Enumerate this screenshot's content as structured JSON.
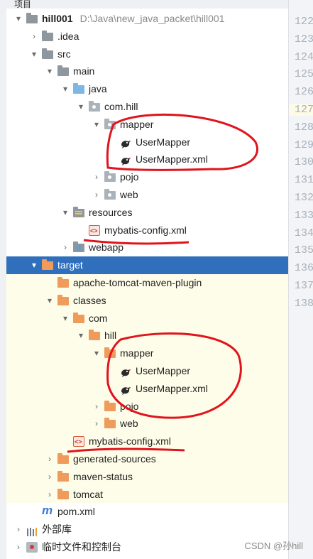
{
  "toolbar": {
    "tab_label": "项目"
  },
  "tree": {
    "rows": [
      {
        "indent": 0,
        "arrow": "▾",
        "icon": "gray-folder",
        "label": "hill001",
        "hint": "D:\\Java\\new_java_packet\\hill001",
        "bold": true
      },
      {
        "indent": 1,
        "arrow": "›",
        "icon": "gray-folder",
        "label": ".idea"
      },
      {
        "indent": 1,
        "arrow": "▾",
        "icon": "gray-folder",
        "label": "src"
      },
      {
        "indent": 2,
        "arrow": "▾",
        "icon": "gray-folder",
        "label": "main"
      },
      {
        "indent": 3,
        "arrow": "▾",
        "icon": "blue-folder",
        "label": "java"
      },
      {
        "indent": 4,
        "arrow": "▾",
        "icon": "package-folder",
        "label": "com.hill"
      },
      {
        "indent": 5,
        "arrow": "▾",
        "icon": "package-folder",
        "label": "mapper"
      },
      {
        "indent": 6,
        "arrow": "",
        "icon": "mybatis-bird",
        "label": "UserMapper"
      },
      {
        "indent": 6,
        "arrow": "",
        "icon": "mybatis-bird",
        "label": "UserMapper.xml"
      },
      {
        "indent": 5,
        "arrow": "›",
        "icon": "package-folder",
        "label": "pojo"
      },
      {
        "indent": 5,
        "arrow": "›",
        "icon": "package-folder",
        "label": "web"
      },
      {
        "indent": 3,
        "arrow": "▾",
        "icon": "resources-folder",
        "label": "resources"
      },
      {
        "indent": 4,
        "arrow": "",
        "icon": "xml-file",
        "label": "mybatis-config.xml"
      },
      {
        "indent": 3,
        "arrow": "›",
        "icon": "web-folder",
        "label": "webapp"
      },
      {
        "indent": 1,
        "arrow": "▾",
        "icon": "orange-folder",
        "label": "target",
        "selected": true
      },
      {
        "indent": 2,
        "arrow": "",
        "icon": "orange-folder",
        "label": "apache-tomcat-maven-plugin",
        "yellow": true
      },
      {
        "indent": 2,
        "arrow": "▾",
        "icon": "orange-folder",
        "label": "classes",
        "yellow": true
      },
      {
        "indent": 3,
        "arrow": "▾",
        "icon": "orange-folder",
        "label": "com",
        "yellow": true
      },
      {
        "indent": 4,
        "arrow": "▾",
        "icon": "orange-folder",
        "label": "hill",
        "yellow": true
      },
      {
        "indent": 5,
        "arrow": "▾",
        "icon": "orange-folder",
        "label": "mapper",
        "yellow": true
      },
      {
        "indent": 6,
        "arrow": "",
        "icon": "mybatis-bird",
        "label": "UserMapper",
        "yellow": true
      },
      {
        "indent": 6,
        "arrow": "",
        "icon": "mybatis-bird",
        "label": "UserMapper.xml",
        "yellow": true
      },
      {
        "indent": 5,
        "arrow": "›",
        "icon": "orange-folder",
        "label": "pojo",
        "yellow": true
      },
      {
        "indent": 5,
        "arrow": "›",
        "icon": "orange-folder",
        "label": "web",
        "yellow": true
      },
      {
        "indent": 3,
        "arrow": "",
        "icon": "xml-file",
        "label": "mybatis-config.xml",
        "yellow": true
      },
      {
        "indent": 2,
        "arrow": "›",
        "icon": "orange-folder",
        "label": "generated-sources",
        "yellow": true
      },
      {
        "indent": 2,
        "arrow": "›",
        "icon": "orange-folder",
        "label": "maven-status",
        "yellow": true
      },
      {
        "indent": 2,
        "arrow": "›",
        "icon": "orange-folder",
        "label": "tomcat",
        "yellow": true
      },
      {
        "indent": 1,
        "arrow": "",
        "icon": "maven-m",
        "label": "pom.xml"
      },
      {
        "indent": 0,
        "arrow": "›",
        "icon": "library-bars",
        "label": "外部库"
      },
      {
        "indent": 0,
        "arrow": "›",
        "icon": "scratches",
        "label": "临时文件和控制台"
      }
    ]
  },
  "gutter": {
    "line_numbers": [
      "122",
      "123",
      "124",
      "125",
      "126",
      "127",
      "128",
      "129",
      "130",
      "131",
      "132",
      "133",
      "134",
      "135",
      "136",
      "137",
      "138"
    ],
    "highlighted_line": "127"
  },
  "watermark": {
    "text": "CSDN @孙hill"
  },
  "colors": {
    "selection": "#2f6fbc",
    "target_bg": "#fefde9",
    "annotation": "#e0141c"
  }
}
